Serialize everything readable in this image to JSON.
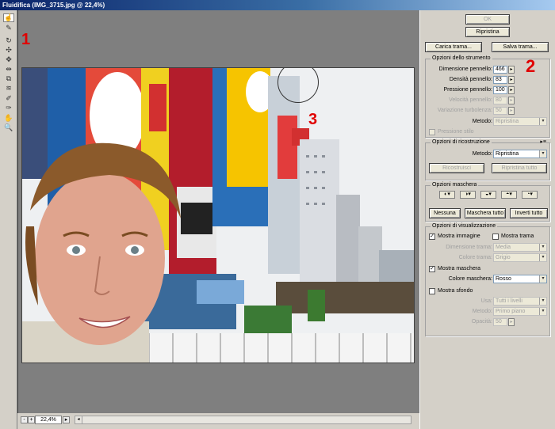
{
  "window": {
    "title": "Fluidifica (IMG_3715.jpg @ 22,4%)"
  },
  "callouts": {
    "one": "1",
    "two": "2",
    "three": "3"
  },
  "toolbar": {
    "tools": [
      {
        "name": "forward-warp-tool-icon",
        "glyph": "☝"
      },
      {
        "name": "reconstruct-tool-icon",
        "glyph": "✎"
      },
      {
        "name": "twirl-clockwise-tool-icon",
        "glyph": "↻"
      },
      {
        "name": "pucker-tool-icon",
        "glyph": "✣"
      },
      {
        "name": "bloat-tool-icon",
        "glyph": "✥"
      },
      {
        "name": "push-left-tool-icon",
        "glyph": "⇹"
      },
      {
        "name": "mirror-tool-icon",
        "glyph": "⧉"
      },
      {
        "name": "turbulence-tool-icon",
        "glyph": "≋"
      },
      {
        "name": "freeze-mask-tool-icon",
        "glyph": "✐"
      },
      {
        "name": "thaw-mask-tool-icon",
        "glyph": "✑"
      },
      {
        "name": "hand-tool-icon",
        "glyph": "✋"
      },
      {
        "name": "zoom-tool-icon",
        "glyph": "🔍"
      }
    ]
  },
  "status": {
    "zoom": "22,4%",
    "minus": "-",
    "plus": "+"
  },
  "panel": {
    "ok": "OK",
    "reset": "Ripristina",
    "load_mesh": "Carica trama...",
    "save_mesh": "Salva trama...",
    "tool_options": {
      "title": "Opzioni dello strumento",
      "brush_size_label": "Dimensione pennello:",
      "brush_size": "466",
      "brush_density_label": "Densità pennello:",
      "brush_density": "83",
      "brush_pressure_label": "Pressione pennello:",
      "brush_pressure": "100",
      "brush_rate_label": "Velocità pennello:",
      "brush_rate": "80",
      "turbulent_jitter_label": "Variazione turbolenza:",
      "turbulent_jitter": "50",
      "mode_label": "Metodo:",
      "mode": "Ripristina",
      "stylus_pressure": "Pressione stilo"
    },
    "reconstruct": {
      "title": "Opzioni di ricostruzione",
      "mode_label": "Metodo:",
      "mode": "Ripristina",
      "reconstruct_btn": "Ricostruisci",
      "restore_all_btn": "Ripristina tutto"
    },
    "mask": {
      "title": "Opzioni maschera",
      "none_btn": "Nessuna",
      "mask_all_btn": "Maschera tutto",
      "invert_all_btn": "Inverti tutto"
    },
    "view": {
      "title": "Opzioni di visualizzazione",
      "show_image": "Mostra immagine",
      "show_mesh": "Mostra trama",
      "mesh_size_label": "Dimensione trama:",
      "mesh_size": "Media",
      "mesh_color_label": "Colore trama:",
      "mesh_color": "Grigio",
      "show_mask": "Mostra maschera",
      "mask_color_label": "Colore maschera:",
      "mask_color": "Rosso",
      "show_backdrop": "Mostra sfondo",
      "use_label": "Usa:",
      "use": "Tutti i livelli",
      "mode_label": "Metodo:",
      "mode": "Primo piano",
      "opacity_label": "Opacità:",
      "opacity": "50"
    }
  }
}
